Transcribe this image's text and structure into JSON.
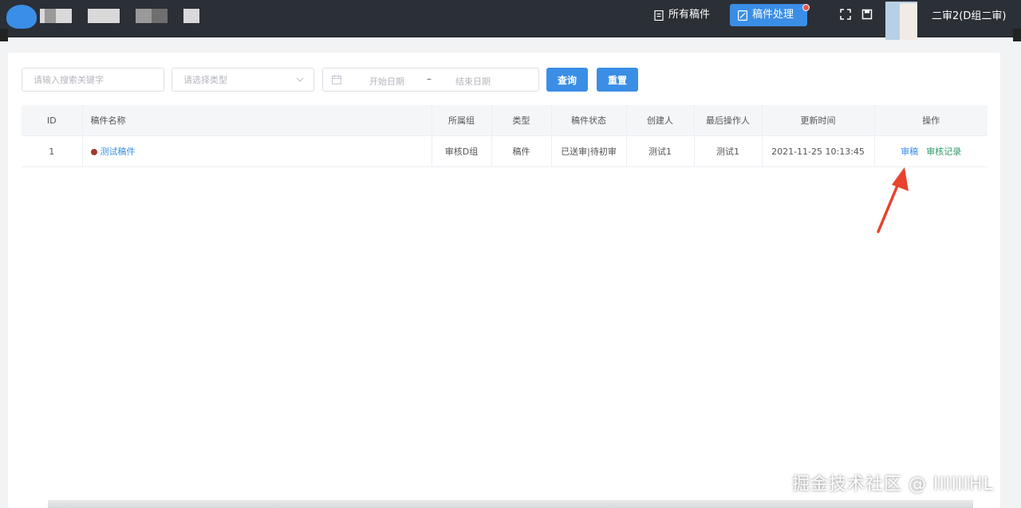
{
  "header": {
    "nav": {
      "all_manuscripts": "所有稿件",
      "manuscript_processing": "稿件处理"
    },
    "user": {
      "name": "二审2(D组二审)"
    }
  },
  "filters": {
    "keyword_placeholder": "请输入搜索关键字",
    "type_placeholder": "请选择类型",
    "start_date_placeholder": "开始日期",
    "date_separator": "–",
    "end_date_placeholder": "结束日期",
    "query_label": "查询",
    "reset_label": "重置"
  },
  "table": {
    "columns": [
      "ID",
      "稿件名称",
      "所属组",
      "类型",
      "稿件状态",
      "创建人",
      "最后操作人",
      "更新时间",
      "操作"
    ],
    "rows": [
      {
        "id": "1",
        "name": "测试稿件",
        "group": "审核D组",
        "type": "稿件",
        "status": "已送审|待初审",
        "creator": "测试1",
        "last_operator": "测试1",
        "updated_at": "2021-11-25 10:13:45",
        "actions": {
          "review": "审稿",
          "review_log": "审核记录"
        }
      }
    ]
  },
  "watermark": "掘金技术社区 @ IIIIIIHL",
  "colors": {
    "topbar": "#2b2f36",
    "primary": "#3a8ee6",
    "link_green": "#2e9a6a",
    "status_dot": "#a23a2a",
    "arrow": "#e8432e"
  }
}
